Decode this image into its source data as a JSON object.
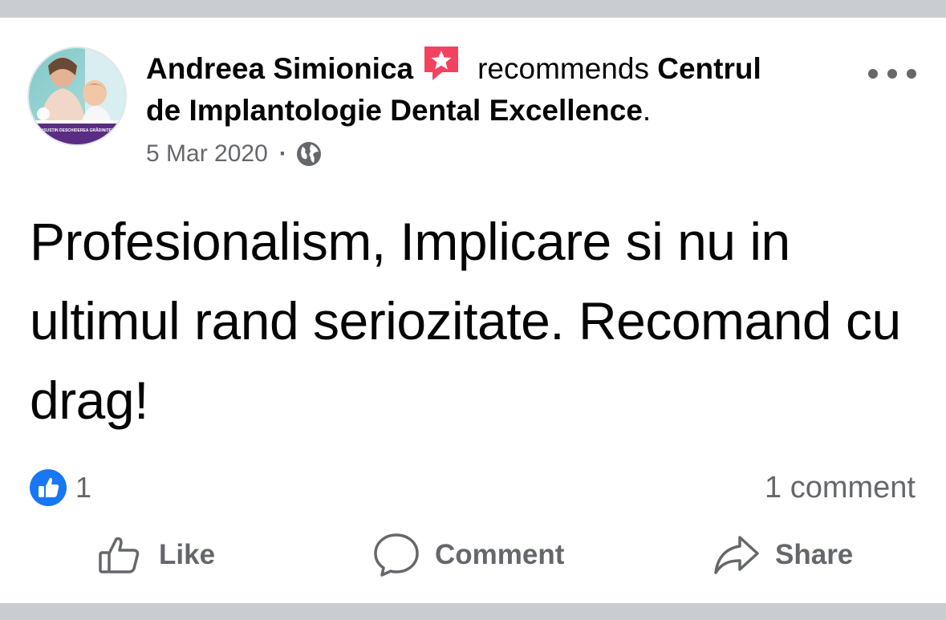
{
  "post": {
    "author": "Andreea Simionica",
    "verb": "recommends",
    "page_name": "Centrul de Implantologie Dental Excellence",
    "page_name_line1": "Centrul",
    "page_name_line2": "de Implantologie Dental Excellence",
    "period": ".",
    "date": "5 Mar 2020",
    "separator": "·",
    "privacy_icon": "globe-icon",
    "badge_icon": "recommendation-star-icon",
    "avatar_banner_text": "#SUSȚIN DESCHIDEREA GRĂDINIȚEI",
    "body": "Profesionalism, Implicare si nu in ultimul rand seriozitate. Recomand cu drag!"
  },
  "reactions": {
    "icon": "like-reaction-icon",
    "count": "1",
    "comments": "1 comment"
  },
  "actions": {
    "like": "Like",
    "comment": "Comment",
    "share": "Share"
  },
  "colors": {
    "band": "#c9ccd1",
    "text": "#050505",
    "secondary": "#65676b",
    "like_blue": "#1877f2",
    "badge_red": "#f3425f"
  }
}
